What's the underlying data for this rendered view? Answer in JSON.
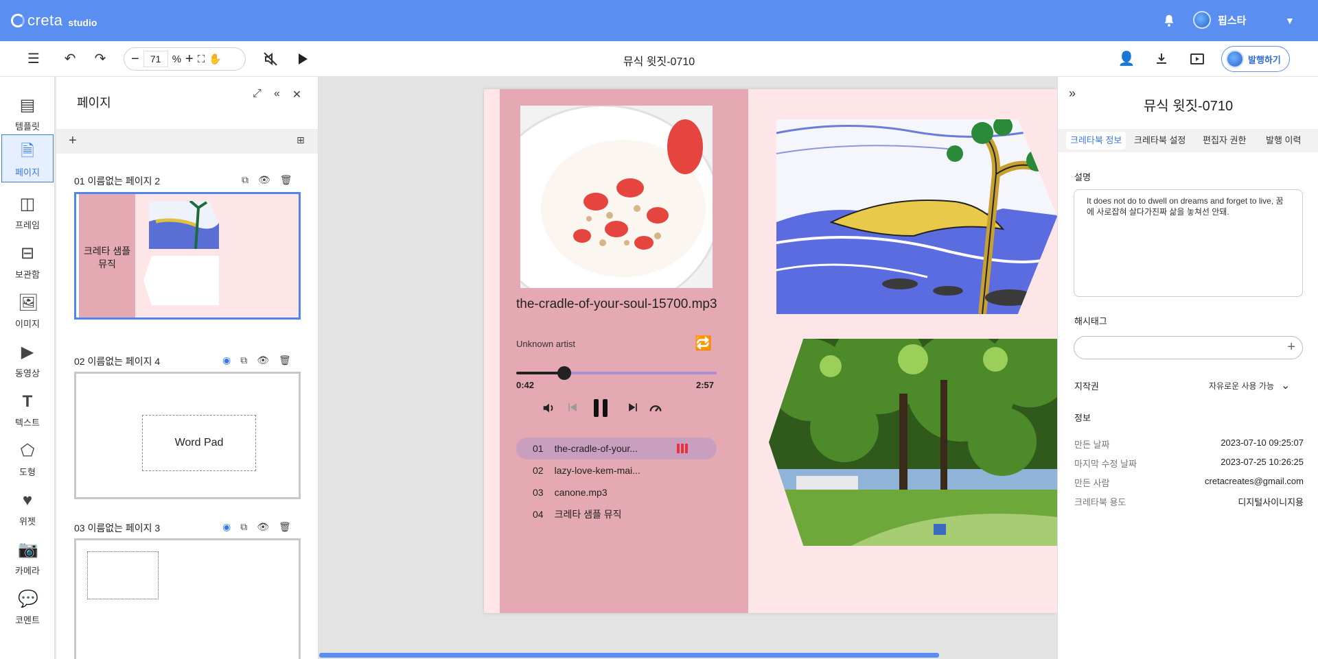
{
  "app": {
    "logo_text": "creta",
    "logo_sub": "studio"
  },
  "header": {
    "user_name": "핍스타"
  },
  "toolbar": {
    "zoom_value": "71",
    "zoom_unit": "%",
    "doc_title": "뮤식 윗짓-0710",
    "publish_label": "발행하기"
  },
  "rail": {
    "items": [
      {
        "label": "템플릿",
        "icon": "template-icon"
      },
      {
        "label": "페이지",
        "icon": "page-icon"
      },
      {
        "label": "프레임",
        "icon": "frame-icon"
      },
      {
        "label": "보관함",
        "icon": "archive-icon"
      },
      {
        "label": "이미지",
        "icon": "image-icon"
      },
      {
        "label": "동영상",
        "icon": "video-icon"
      },
      {
        "label": "텍스트",
        "icon": "text-icon"
      },
      {
        "label": "도형",
        "icon": "shape-icon"
      },
      {
        "label": "위젯",
        "icon": "widget-icon"
      },
      {
        "label": "카메라",
        "icon": "camera-icon"
      },
      {
        "label": "코멘트",
        "icon": "comment-icon"
      }
    ]
  },
  "pages_panel": {
    "title": "페이지",
    "pages": [
      {
        "label": "01  이름없는 페이지 2",
        "thumb_text": "크레타 샘플 뮤직"
      },
      {
        "label": "02  이름없는 페이지 4",
        "thumb_text": "Word Pad"
      },
      {
        "label": "03  이름없는 페이지 3"
      }
    ]
  },
  "player": {
    "song_title": "the-cradle-of-your-soul-15700.mp3",
    "artist": "Unknown artist",
    "time_current": "0:42",
    "time_total": "2:57",
    "progress": 0.24,
    "playlist": [
      {
        "no": "01",
        "title": "the-cradle-of-your..."
      },
      {
        "no": "02",
        "title": "lazy-love-kem-mai..."
      },
      {
        "no": "03",
        "title": "canone.mp3"
      },
      {
        "no": "04",
        "title": "크레타 샘플 뮤직"
      }
    ]
  },
  "right_panel": {
    "title": "뮤식 윗짓-0710",
    "tabs": [
      "크레타북 정보",
      "크레타북 설정",
      "편집자 권한",
      "발행 이력"
    ],
    "description_label": "설명",
    "description": "It does not do to dwell on dreams and forget to live, 꿈에 사로잡혀 살다가진짜 삶을 놓쳐선 안돼.",
    "hashtag_label": "해시태그",
    "copyright_label": "지작권",
    "copyright_value": "자유로운 사용 가능",
    "info_label": "정보",
    "info": [
      {
        "k": "만든 날짜",
        "v": "2023-07-10 09:25:07"
      },
      {
        "k": "마지막 수정 날짜",
        "v": "2023-07-25 10:26:25"
      },
      {
        "k": "만든 사람",
        "v": "cretacreates@gmail.com"
      },
      {
        "k": "크레타북 용도",
        "v": "디지털사이니지용"
      }
    ]
  },
  "colors": {
    "brand_blue": "#5a8ef0",
    "page_pink": "#fde5e8",
    "column_pink": "#e4a9b2",
    "active_track": "#c99fc0",
    "playing_red": "#e7323d"
  }
}
